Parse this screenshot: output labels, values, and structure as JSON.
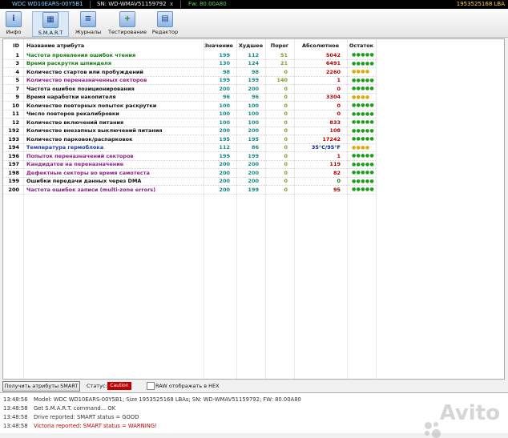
{
  "titlebar": {
    "model": "WDC WD10EARS-00Y5B1",
    "sn": "SN: WD-WMAV51159792",
    "close": "x",
    "fw": "Fw: 80.00A80",
    "lba": "1953525168 LBA"
  },
  "toolbar": {
    "buttons": [
      {
        "label": "Инфо",
        "icon": "info-icon"
      },
      {
        "label": "S.M.A.R.T",
        "icon": "smart-icon"
      },
      {
        "label": "Журналы",
        "icon": "logs-icon"
      },
      {
        "label": "Тестирование",
        "icon": "test-icon"
      },
      {
        "label": "Редактор",
        "icon": "editor-icon"
      }
    ]
  },
  "table": {
    "headers": {
      "id": "ID",
      "name": "Название атрибута",
      "value": "Значение",
      "worst": "Худшее",
      "threshold": "Порог",
      "raw": "Абсолютное",
      "health": "Остаток"
    },
    "rows": [
      {
        "id": "1",
        "name": "Частота проявления ошибок чтения",
        "value": "199",
        "worst": "112",
        "thr": "51",
        "raw": "5042",
        "health": "●●●●●"
      },
      {
        "id": "3",
        "name": "Время раскрутки шпинделя",
        "value": "130",
        "worst": "124",
        "thr": "21",
        "raw": "6491",
        "health": "●●●●●"
      },
      {
        "id": "4",
        "name": "Количество стартов или пробуждений",
        "value": "98",
        "worst": "98",
        "thr": "0",
        "raw": "2260",
        "health": "●●●●"
      },
      {
        "id": "5",
        "name": "Количество переназначенных секторов",
        "value": "199",
        "worst": "199",
        "thr": "140",
        "raw": "1",
        "health": "●●●●●"
      },
      {
        "id": "7",
        "name": "Частота ошибок позиционирования",
        "value": "200",
        "worst": "200",
        "thr": "0",
        "raw": "0",
        "health": "●●●●●"
      },
      {
        "id": "9",
        "name": "Время наработки накопителя",
        "value": "96",
        "worst": "96",
        "thr": "0",
        "raw": "3304",
        "health": "●●●●"
      },
      {
        "id": "10",
        "name": "Количество повторных попыток раскрутки",
        "value": "100",
        "worst": "100",
        "thr": "0",
        "raw": "0",
        "health": "●●●●●"
      },
      {
        "id": "11",
        "name": "Число повторов рекалибровки",
        "value": "100",
        "worst": "100",
        "thr": "0",
        "raw": "0",
        "health": "●●●●●"
      },
      {
        "id": "12",
        "name": "Количество включений питания",
        "value": "100",
        "worst": "100",
        "thr": "0",
        "raw": "833",
        "health": "●●●●●"
      },
      {
        "id": "192",
        "name": "Количество внезапных выключений питания",
        "value": "200",
        "worst": "200",
        "thr": "0",
        "raw": "108",
        "health": "●●●●●"
      },
      {
        "id": "193",
        "name": "Количество парковок/распарковок",
        "value": "195",
        "worst": "195",
        "thr": "0",
        "raw": "17242",
        "health": "●●●●●"
      },
      {
        "id": "194",
        "name": "Температура гермоблока",
        "value": "112",
        "worst": "86",
        "thr": "0",
        "raw": "35°C/95°F",
        "health": "●●●●"
      },
      {
        "id": "196",
        "name": "Попыток переназначений секторов",
        "value": "199",
        "worst": "199",
        "thr": "0",
        "raw": "1",
        "health": "●●●●●"
      },
      {
        "id": "197",
        "name": "Кандидатов на переназначение",
        "value": "200",
        "worst": "200",
        "thr": "0",
        "raw": "119",
        "health": "●●●●●"
      },
      {
        "id": "198",
        "name": "Дефектные секторы во время самотеста",
        "value": "200",
        "worst": "200",
        "thr": "0",
        "raw": "82",
        "health": "●●●●●"
      },
      {
        "id": "199",
        "name": "Ошибки передачи данных через DMA",
        "value": "200",
        "worst": "200",
        "thr": "0",
        "raw": "0",
        "health": "●●●●●"
      },
      {
        "id": "200",
        "name": "Частота ошибок записи (multi-zone errors)",
        "value": "200",
        "worst": "199",
        "thr": "0",
        "raw": "95",
        "health": "●●●●●"
      }
    ]
  },
  "bottom": {
    "get_button": "Получить атрибуты SMART",
    "status_label": "Статус:",
    "status_value": "Caution",
    "hex_label": "RAW отображать в HEX"
  },
  "log": [
    {
      "time": "13:48:56",
      "msg": "Model: WDC WD10EARS-00Y5B1; Size 1953525168 LBAs; SN: WD-WMAV51159792; FW: 80.00A80"
    },
    {
      "time": "13:48:58",
      "msg": "Get S.M.A.R.T. command... OK"
    },
    {
      "time": "13:48:58",
      "msg": "Drive reported: SMART status = GOOD"
    },
    {
      "time": "13:48:58",
      "msg": "Victoria reported: SMART status = WARNING!"
    }
  ],
  "watermark": "Avito",
  "colors": {
    "status_caution": "#c00000",
    "health_good": "#18a018",
    "health_warn": "#e0a800"
  }
}
